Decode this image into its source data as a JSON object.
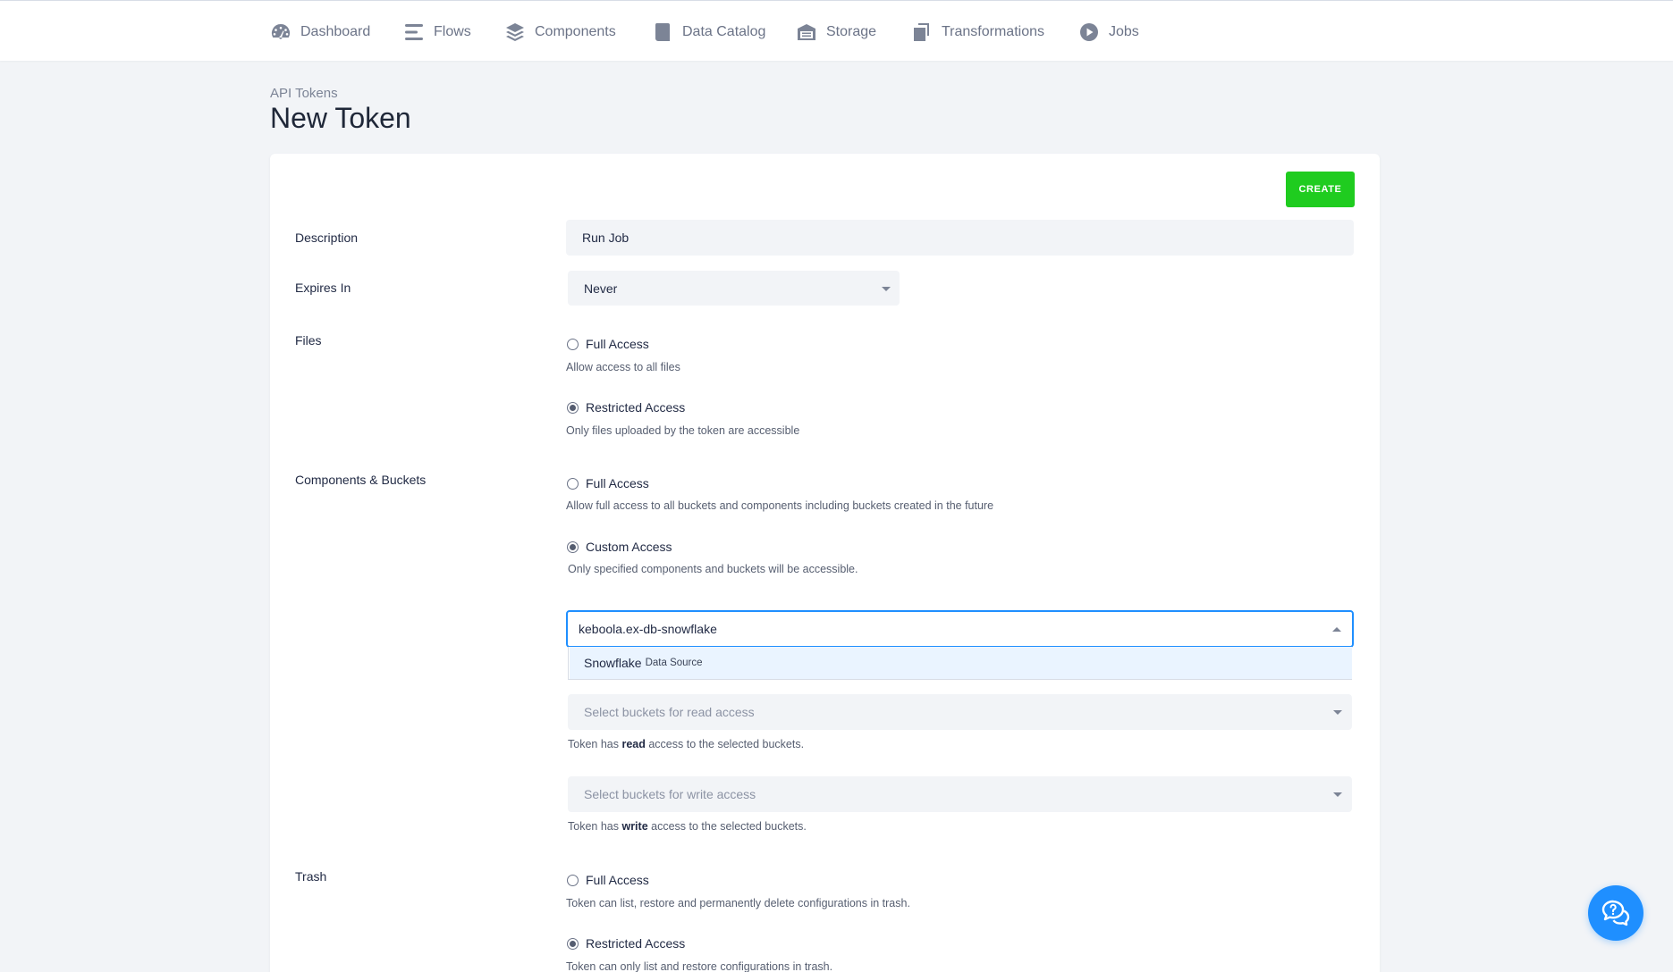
{
  "nav": {
    "items": [
      {
        "label": "Dashboard",
        "icon": "dashboard-icon"
      },
      {
        "label": "Flows",
        "icon": "flows-icon"
      },
      {
        "label": "Components",
        "icon": "components-icon"
      },
      {
        "label": "Data Catalog",
        "icon": "data-catalog-icon"
      },
      {
        "label": "Storage",
        "icon": "storage-icon"
      },
      {
        "label": "Transformations",
        "icon": "transformations-icon"
      },
      {
        "label": "Jobs",
        "icon": "jobs-icon"
      }
    ]
  },
  "breadcrumb": "API Tokens",
  "title": "New Token",
  "create_label": "CREATE",
  "form": {
    "description": {
      "label": "Description",
      "value": "Run Job"
    },
    "expires": {
      "label": "Expires In",
      "value": "Never"
    },
    "files": {
      "label": "Files",
      "full": {
        "label": "Full Access",
        "help": "Allow access to all files"
      },
      "restricted": {
        "label": "Restricted Access",
        "help": "Only files uploaded by the token are accessible"
      }
    },
    "components": {
      "label": "Components & Buckets",
      "full": {
        "label": "Full Access",
        "help": "Allow full access to all buckets and components including buckets created in the future"
      },
      "custom": {
        "label": "Custom Access",
        "help": "Only specified components and buckets will be accessible."
      },
      "component_search": "keboola.ex-db-snowflake",
      "option": {
        "name": "Snowflake",
        "sub": "Data Source"
      },
      "read": {
        "placeholder": "Select buckets for read access",
        "help_prefix": "Token has ",
        "help_bold": "read",
        "help_suffix": " access to the selected buckets."
      },
      "write": {
        "placeholder": "Select buckets for write access",
        "help_prefix": "Token has ",
        "help_bold": "write",
        "help_suffix": " access to the selected buckets."
      }
    },
    "trash": {
      "label": "Trash",
      "full": {
        "label": "Full Access",
        "help": "Token can list, restore and permanently delete configurations in trash."
      },
      "restricted": {
        "label": "Restricted Access",
        "help": "Token can only list and restore configurations in trash."
      }
    }
  },
  "colors": {
    "accent": "#1f8fff",
    "create": "#1fcc1f"
  }
}
